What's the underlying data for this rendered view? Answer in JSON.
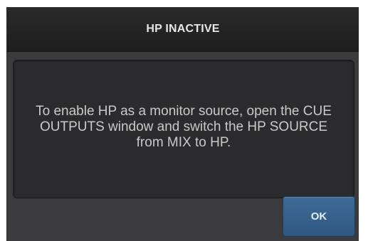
{
  "dialog": {
    "title": "HP INACTIVE",
    "message": "To enable HP as a monitor source, open the CUE OUTPUTS window and switch the HP SOURCE from MIX to HP.",
    "ok_label": "OK"
  },
  "colors": {
    "titlebar": "#1e1e1e",
    "dialog_background": "#3b3b3d",
    "message_panel": "#2b2b2d",
    "ok_button": "#2f577f"
  }
}
